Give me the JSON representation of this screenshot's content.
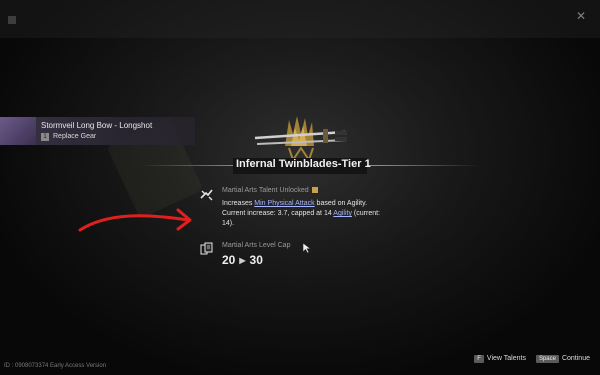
{
  "selected_item": {
    "name": "Stormveil Long Bow - Longshot",
    "key": "1",
    "action": "Replace Gear"
  },
  "panel": {
    "title": "Infernal Twinblades-Tier 1",
    "talent": {
      "label": "Martial Arts Talent Unlocked",
      "desc_prefix": "Increases ",
      "desc_link": "Min Physical Attack",
      "desc_mid": " based on Agility.",
      "current_prefix": "Current increase: 3.7, capped at 14 ",
      "current_link": "Agility",
      "current_suffix": " (current:",
      "current_value": "14)."
    },
    "level_cap": {
      "label": "Martial Arts Level Cap",
      "from": "20",
      "to": "30"
    }
  },
  "footer": {
    "build_id": "ID : 0908073374 Early Access Version",
    "view_talents_key": "F",
    "view_talents_label": "View Talents",
    "continue_key": "Space",
    "continue_label": "Continue"
  },
  "colors": {
    "link": "#a5b6ff",
    "annotation_arrow": "#e0201e",
    "item_card": "#3a3446"
  },
  "icons": [
    "weapon-twinblades-icon",
    "talent-icon",
    "level-cap-icon",
    "cursor-icon",
    "red-annotation-arrow"
  ]
}
